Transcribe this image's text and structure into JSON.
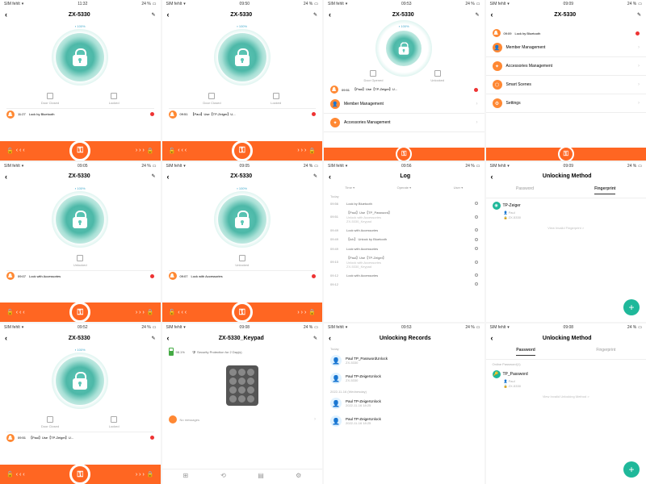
{
  "status": {
    "carrier": "SIM fehlt",
    "wifi": "▾",
    "battery_pct": "24 %",
    "battery_icon": "▢"
  },
  "device": "ZX-5330",
  "keypad_device": "ZX-5330_Keypad",
  "battery_label": "100%",
  "door_closed": "Door Closed",
  "door_opened": "Door Opened",
  "locked": "Locked",
  "unlocked": "Unlocked",
  "edit": "✎",
  "back": "‹",
  "more": ":",
  "screens": [
    {
      "time": "11:32",
      "event_time": "11:27",
      "event": "Lock by Bluetooth",
      "status_l": "Door Closed",
      "status_r": "Locked"
    },
    {
      "time": "09:50",
      "event_time": "09:51",
      "event": "【Paul】Use【TP-Zeiger】U...",
      "status_l": "Door Closed",
      "status_r": "Locked"
    },
    {
      "time": "09:53",
      "event_time": "09:51",
      "event": "",
      "status_l": "Door Opened",
      "status_r": "Unlocked"
    },
    {
      "time": "09:09",
      "event_time": "09:09",
      "event": "Lock by Bluetooth"
    },
    {
      "time": "09:05",
      "event_time": "09:07",
      "event": "Lock with Accessories",
      "status_l": "",
      "status_r": "Unlocked"
    },
    {
      "time": "09:05",
      "event_time": "09:07",
      "event": "Lock with Accessories",
      "status_l": "",
      "status_r": "Unlocked"
    },
    {
      "time": "09:52",
      "event_time": "09:51",
      "event": "【Paul】Use【TP-Zeiger】U...",
      "status_l": "Door Closed",
      "status_r": "Locked"
    }
  ],
  "menu": {
    "member": "Member Management",
    "accessories": "Accessories Management",
    "scenes": "Smart Scenes",
    "settings": "Settings"
  },
  "log": {
    "title": "Log",
    "tabs": {
      "time": "Time ▾",
      "operate": "Operate ▾",
      "user": "User ▾"
    },
    "today": "Today",
    "rows": [
      {
        "t": "09:56",
        "txt": "Lock by Bluetooth"
      },
      {
        "t": "09:51",
        "txt": "【Paul】Use【TP_Password】",
        "sub": "Unlock with Accessories",
        "sub2": "ZX-5330_Keypad"
      },
      {
        "t": "09:49",
        "txt": "Lock with Accessories"
      },
      {
        "t": "09:49",
        "txt": "【Ich】 Unlock by Bluetooth"
      },
      {
        "t": "09:49",
        "txt": "Lock with Accessories"
      },
      {
        "t": "09:10",
        "txt": "【Paul】Use【TP-Zeiger】",
        "sub": "Unlock with Accessories",
        "sub2": "ZX-5330_Keypad"
      },
      {
        "t": "09:12",
        "txt": "Lock with Accessories"
      },
      {
        "t": "09:12",
        "txt": ""
      }
    ]
  },
  "unlock": {
    "title": "Unlocking Method",
    "tab_pw": "Password",
    "tab_fp": "Fingerprint",
    "fp_name": "TP-Zeiger",
    "fp_user": "Paul",
    "fp_device": "ZX-5330",
    "view_invalid_fp": "View Invalid Fingerprint >",
    "online_pw": "Online Password(1)",
    "pw_name": "TP_Password",
    "view_invalid_pw": "View Invalid Unlocking Method >"
  },
  "keypad": {
    "batt": "98.1%",
    "protection": "Security Protection for 2 Day(s)",
    "no_msg": "No messages"
  },
  "records": {
    "title": "Unlocking Records",
    "today": "Today",
    "wed": "2022-11-16 (Wednesday)",
    "items": [
      {
        "name": "Paul TP_PasswordUnlock",
        "sub": "ZX-5330"
      },
      {
        "name": "Paul TP-ZeigerUnlock",
        "sub": "ZX-5330"
      },
      {
        "name": "Paul TP-ZeigerUnlock",
        "sub": "2022-11-16 18:25"
      },
      {
        "name": "Paul TP-ZeigerUnlock",
        "sub": "2022-11-16 18:25"
      }
    ]
  },
  "slider": {
    "unlock": "🔓",
    "lock": "🔒",
    "arrows_l": "‹ ‹ ‹",
    "arrows_r": "› › ›",
    "key": "⚿"
  }
}
